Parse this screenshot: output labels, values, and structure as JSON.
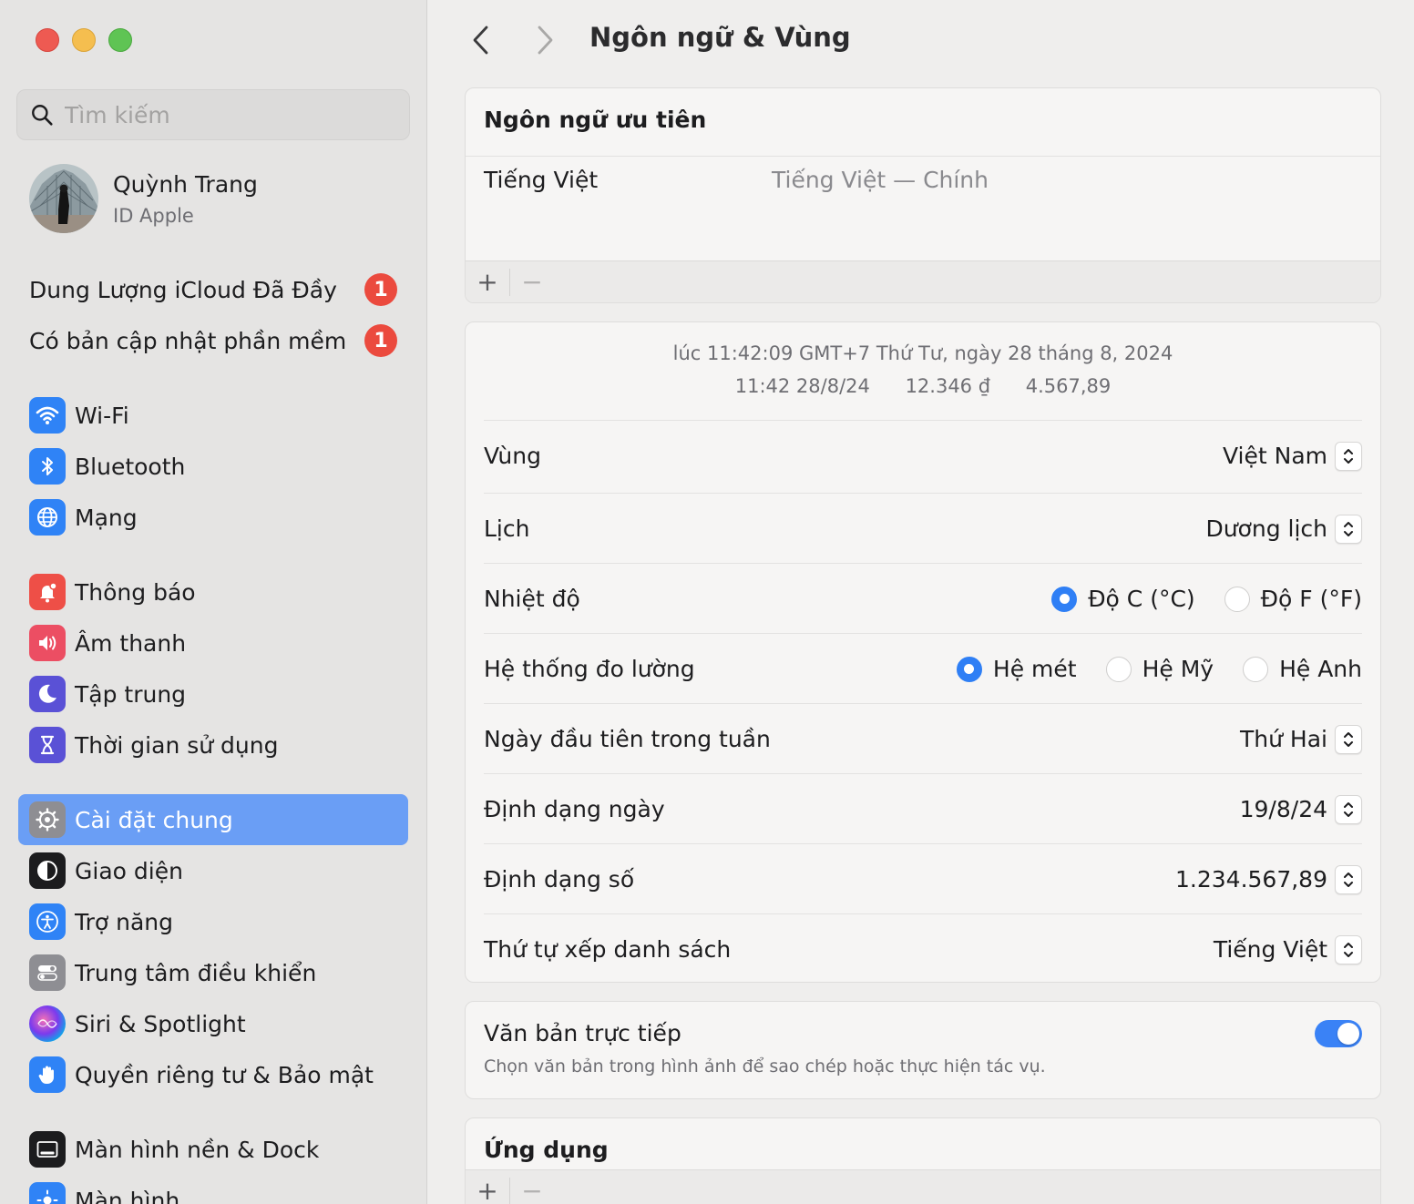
{
  "sidebar": {
    "search_placeholder": "Tìm kiếm",
    "profile": {
      "name": "Quỳnh Trang",
      "subtitle": "ID Apple"
    },
    "alerts": [
      {
        "label": "Dung Lượng iCloud Đã Đầy",
        "badge": "1"
      },
      {
        "label": "Có bản cập nhật phần mềm",
        "badge": "1"
      }
    ],
    "items": [
      {
        "label": "Wi-Fi",
        "icon": "wifi-icon"
      },
      {
        "label": "Bluetooth",
        "icon": "bluetooth-icon"
      },
      {
        "label": "Mạng",
        "icon": "globe-icon"
      },
      {
        "label": "Thông báo",
        "icon": "bell-icon"
      },
      {
        "label": "Âm thanh",
        "icon": "speaker-icon"
      },
      {
        "label": "Tập trung",
        "icon": "moon-icon"
      },
      {
        "label": "Thời gian sử dụng",
        "icon": "hourglass-icon"
      },
      {
        "label": "Cài đặt chung",
        "icon": "gear-icon",
        "active": true
      },
      {
        "label": "Giao diện",
        "icon": "appearance-icon"
      },
      {
        "label": "Trợ năng",
        "icon": "accessibility-icon"
      },
      {
        "label": "Trung tâm điều khiển",
        "icon": "toggles-icon"
      },
      {
        "label": "Siri & Spotlight",
        "icon": "siri-icon"
      },
      {
        "label": "Quyền riêng tư & Bảo mật",
        "icon": "hand-icon"
      },
      {
        "label": "Màn hình nền & Dock",
        "icon": "dock-icon"
      },
      {
        "label": "Màn hình",
        "icon": "display-icon"
      }
    ]
  },
  "toolbar": {
    "title": "Ngôn ngữ & Vùng"
  },
  "preferred_languages": {
    "title": "Ngôn ngữ ưu tiên",
    "languages": [
      {
        "name": "Tiếng Việt",
        "description": "Tiếng Việt — Chính"
      }
    ],
    "add_label": "+",
    "remove_label": "−"
  },
  "region": {
    "preview_line1": "lúc 11:42:09 GMT+7 Thứ Tư, ngày 28 tháng 8, 2024",
    "preview_line2": [
      "11:42 28/8/24",
      "12.346 ₫",
      "4.567,89"
    ],
    "rows": {
      "region": {
        "label": "Vùng",
        "value": "Việt Nam"
      },
      "calendar": {
        "label": "Lịch",
        "value": "Dương lịch"
      },
      "temperature": {
        "label": "Nhiệt độ",
        "options": [
          "Độ C (°C)",
          "Độ F (°F)"
        ],
        "selected": 0
      },
      "measurement": {
        "label": "Hệ thống đo lường",
        "options": [
          "Hệ mét",
          "Hệ Mỹ",
          "Hệ Anh"
        ],
        "selected": 0
      },
      "first_day": {
        "label": "Ngày đầu tiên trong tuần",
        "value": "Thứ Hai"
      },
      "date_format": {
        "label": "Định dạng ngày",
        "value": "19/8/24"
      },
      "number_format": {
        "label": "Định dạng số",
        "value": "1.234.567,89"
      },
      "list_sort": {
        "label": "Thứ tự xếp danh sách",
        "value": "Tiếng Việt"
      }
    }
  },
  "live_text": {
    "title": "Văn bản trực tiếp",
    "description": "Chọn văn bản trong hình ảnh để sao chép hoặc thực hiện tác vụ.",
    "enabled": true
  },
  "applications": {
    "title": "Ứng dụng",
    "add_label": "+",
    "remove_label": "−"
  },
  "colors": {
    "accent": "#2f7ff5",
    "sidebar_selected": "#6a9ef5",
    "badge": "#eb4a3e"
  }
}
